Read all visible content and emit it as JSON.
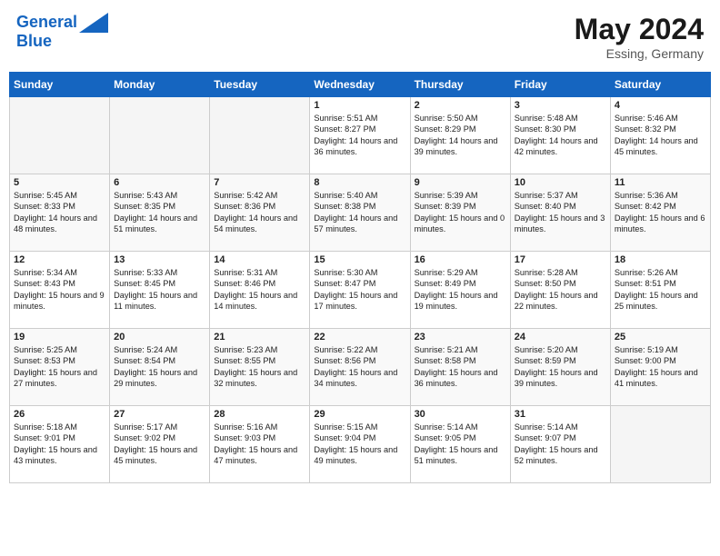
{
  "header": {
    "logo_line1": "General",
    "logo_line2": "Blue",
    "month": "May 2024",
    "location": "Essing, Germany"
  },
  "weekdays": [
    "Sunday",
    "Monday",
    "Tuesday",
    "Wednesday",
    "Thursday",
    "Friday",
    "Saturday"
  ],
  "weeks": [
    {
      "shade": "odd",
      "days": [
        {
          "num": "",
          "empty": true
        },
        {
          "num": "",
          "empty": true
        },
        {
          "num": "",
          "empty": true
        },
        {
          "num": "1",
          "sunrise": "5:51 AM",
          "sunset": "8:27 PM",
          "daylight": "14 hours and 36 minutes."
        },
        {
          "num": "2",
          "sunrise": "5:50 AM",
          "sunset": "8:29 PM",
          "daylight": "14 hours and 39 minutes."
        },
        {
          "num": "3",
          "sunrise": "5:48 AM",
          "sunset": "8:30 PM",
          "daylight": "14 hours and 42 minutes."
        },
        {
          "num": "4",
          "sunrise": "5:46 AM",
          "sunset": "8:32 PM",
          "daylight": "14 hours and 45 minutes."
        }
      ]
    },
    {
      "shade": "even",
      "days": [
        {
          "num": "5",
          "sunrise": "5:45 AM",
          "sunset": "8:33 PM",
          "daylight": "14 hours and 48 minutes."
        },
        {
          "num": "6",
          "sunrise": "5:43 AM",
          "sunset": "8:35 PM",
          "daylight": "14 hours and 51 minutes."
        },
        {
          "num": "7",
          "sunrise": "5:42 AM",
          "sunset": "8:36 PM",
          "daylight": "14 hours and 54 minutes."
        },
        {
          "num": "8",
          "sunrise": "5:40 AM",
          "sunset": "8:38 PM",
          "daylight": "14 hours and 57 minutes."
        },
        {
          "num": "9",
          "sunrise": "5:39 AM",
          "sunset": "8:39 PM",
          "daylight": "15 hours and 0 minutes."
        },
        {
          "num": "10",
          "sunrise": "5:37 AM",
          "sunset": "8:40 PM",
          "daylight": "15 hours and 3 minutes."
        },
        {
          "num": "11",
          "sunrise": "5:36 AM",
          "sunset": "8:42 PM",
          "daylight": "15 hours and 6 minutes."
        }
      ]
    },
    {
      "shade": "odd",
      "days": [
        {
          "num": "12",
          "sunrise": "5:34 AM",
          "sunset": "8:43 PM",
          "daylight": "15 hours and 9 minutes."
        },
        {
          "num": "13",
          "sunrise": "5:33 AM",
          "sunset": "8:45 PM",
          "daylight": "15 hours and 11 minutes."
        },
        {
          "num": "14",
          "sunrise": "5:31 AM",
          "sunset": "8:46 PM",
          "daylight": "15 hours and 14 minutes."
        },
        {
          "num": "15",
          "sunrise": "5:30 AM",
          "sunset": "8:47 PM",
          "daylight": "15 hours and 17 minutes."
        },
        {
          "num": "16",
          "sunrise": "5:29 AM",
          "sunset": "8:49 PM",
          "daylight": "15 hours and 19 minutes."
        },
        {
          "num": "17",
          "sunrise": "5:28 AM",
          "sunset": "8:50 PM",
          "daylight": "15 hours and 22 minutes."
        },
        {
          "num": "18",
          "sunrise": "5:26 AM",
          "sunset": "8:51 PM",
          "daylight": "15 hours and 25 minutes."
        }
      ]
    },
    {
      "shade": "even",
      "days": [
        {
          "num": "19",
          "sunrise": "5:25 AM",
          "sunset": "8:53 PM",
          "daylight": "15 hours and 27 minutes."
        },
        {
          "num": "20",
          "sunrise": "5:24 AM",
          "sunset": "8:54 PM",
          "daylight": "15 hours and 29 minutes."
        },
        {
          "num": "21",
          "sunrise": "5:23 AM",
          "sunset": "8:55 PM",
          "daylight": "15 hours and 32 minutes."
        },
        {
          "num": "22",
          "sunrise": "5:22 AM",
          "sunset": "8:56 PM",
          "daylight": "15 hours and 34 minutes."
        },
        {
          "num": "23",
          "sunrise": "5:21 AM",
          "sunset": "8:58 PM",
          "daylight": "15 hours and 36 minutes."
        },
        {
          "num": "24",
          "sunrise": "5:20 AM",
          "sunset": "8:59 PM",
          "daylight": "15 hours and 39 minutes."
        },
        {
          "num": "25",
          "sunrise": "5:19 AM",
          "sunset": "9:00 PM",
          "daylight": "15 hours and 41 minutes."
        }
      ]
    },
    {
      "shade": "odd",
      "days": [
        {
          "num": "26",
          "sunrise": "5:18 AM",
          "sunset": "9:01 PM",
          "daylight": "15 hours and 43 minutes."
        },
        {
          "num": "27",
          "sunrise": "5:17 AM",
          "sunset": "9:02 PM",
          "daylight": "15 hours and 45 minutes."
        },
        {
          "num": "28",
          "sunrise": "5:16 AM",
          "sunset": "9:03 PM",
          "daylight": "15 hours and 47 minutes."
        },
        {
          "num": "29",
          "sunrise": "5:15 AM",
          "sunset": "9:04 PM",
          "daylight": "15 hours and 49 minutes."
        },
        {
          "num": "30",
          "sunrise": "5:14 AM",
          "sunset": "9:05 PM",
          "daylight": "15 hours and 51 minutes."
        },
        {
          "num": "31",
          "sunrise": "5:14 AM",
          "sunset": "9:07 PM",
          "daylight": "15 hours and 52 minutes."
        },
        {
          "num": "",
          "empty": true
        }
      ]
    }
  ]
}
